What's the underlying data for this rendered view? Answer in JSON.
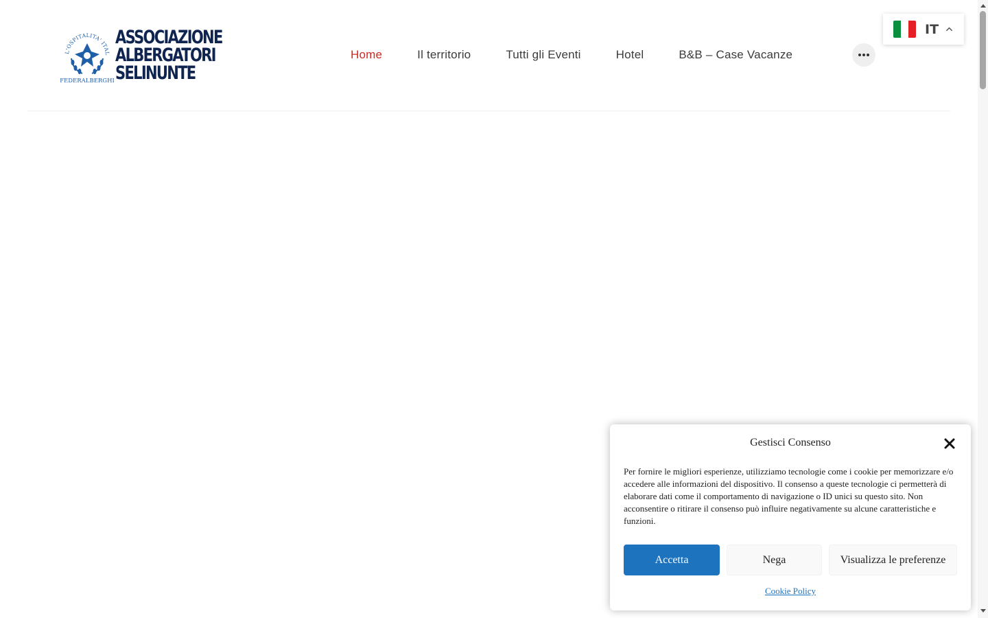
{
  "brand": {
    "name_lines": [
      "ASSOCIAZIONE",
      "ALBERGATORI",
      "SELINUNTE"
    ],
    "emblem_ring_text": "L'OSPITALITA' ITALIANA",
    "emblem_bottom_text": "FEDERALBERGHI",
    "primary_color": "#0f2550",
    "emblem_color": "#1e5fa8"
  },
  "nav": {
    "items": [
      {
        "label": "Home",
        "active": true
      },
      {
        "label": "Il territorio",
        "active": false
      },
      {
        "label": "Tutti gli Eventi",
        "active": false
      },
      {
        "label": "Hotel",
        "active": false
      },
      {
        "label": "B&B – Case Vacanze",
        "active": false
      }
    ],
    "more_icon": "ellipsis-icon",
    "active_color": "#d0281f"
  },
  "language": {
    "code": "IT",
    "flag_icon": "italy-flag-icon",
    "chevron_icon": "chevron-up-icon"
  },
  "consent": {
    "title": "Gestisci Consenso",
    "close_icon": "close-icon",
    "body": "Per fornire le migliori esperienze, utilizziamo tecnologie come i cookie per memorizzare e/o accedere alle informazioni del dispositivo. Il consenso a queste tecnologie ci permetterà di elaborare dati come il comportamento di navigazione o ID unici su questo sito. Non acconsentire o ritirare il consenso può influire negativamente su alcune caratteristiche e funzioni.",
    "accept_label": "Accetta",
    "deny_label": "Nega",
    "preferences_label": "Visualizza le preferenze",
    "cookie_policy_label": "Cookie Policy",
    "accent_color": "#1e73be"
  }
}
